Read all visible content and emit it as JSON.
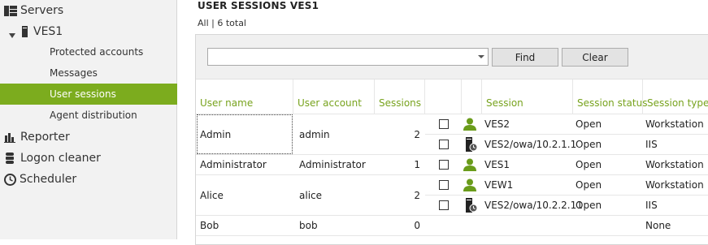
{
  "sidebar": {
    "items": [
      {
        "label": "Servers",
        "icon": "servers-icon"
      },
      {
        "label": "VES1",
        "icon": "server-tower-icon"
      },
      {
        "label": "Protected accounts"
      },
      {
        "label": "Messages"
      },
      {
        "label": "User sessions"
      },
      {
        "label": "Agent distribution"
      },
      {
        "label": "Reporter",
        "icon": "bar-chart-icon"
      },
      {
        "label": "Logon cleaner",
        "icon": "database-icon"
      },
      {
        "label": "Scheduler",
        "icon": "clock-icon"
      }
    ],
    "active_item": "User sessions"
  },
  "header": {
    "title": "USER SESSIONS  VES1",
    "subtitle": "All | 6 total"
  },
  "toolbar": {
    "search_value": "",
    "find_label": "Find",
    "clear_label": "Clear"
  },
  "table": {
    "columns": [
      "User name",
      "User account",
      "Sessions",
      "",
      "",
      "Session",
      "Session status",
      "Session type"
    ],
    "users": [
      {
        "name": "Admin",
        "account": "admin",
        "sessions": "2"
      },
      {
        "name": "Administrator",
        "account": "Administrator",
        "sessions": "1"
      },
      {
        "name": "Alice",
        "account": "alice",
        "sessions": "2"
      },
      {
        "name": "Bob",
        "account": "bob",
        "sessions": "0"
      }
    ],
    "session_rows": [
      {
        "icon": "user-icon",
        "session": "VES2",
        "status": "Open",
        "type": "Workstation"
      },
      {
        "icon": "iis-server-icon",
        "session": "VES2/owa/10.2.1.1",
        "status": "Open",
        "type": "IIS"
      },
      {
        "icon": "user-icon",
        "session": "VES1",
        "status": "Open",
        "type": "Workstation"
      },
      {
        "icon": "user-icon",
        "session": "VEW1",
        "status": "Open",
        "type": "Workstation"
      },
      {
        "icon": "iis-server-icon",
        "session": "VES2/owa/10.2.2.11",
        "status": "Open",
        "type": "IIS"
      },
      {
        "icon": "",
        "session": "",
        "status": "",
        "type": "None"
      }
    ]
  },
  "colors": {
    "accent": "#7cac1e",
    "header_text": "#78a31e",
    "user_icon": "#6a9c1b"
  }
}
